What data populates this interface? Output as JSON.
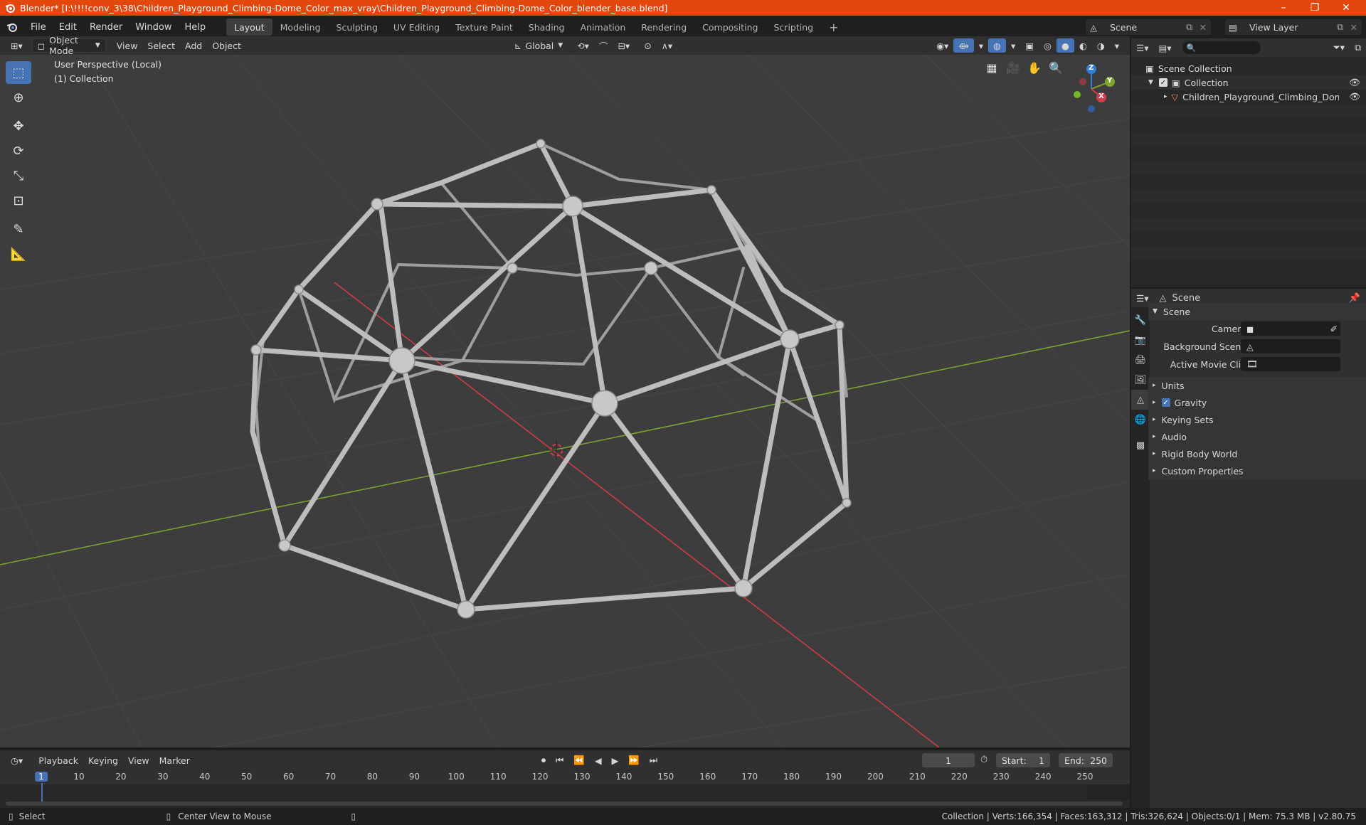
{
  "window": {
    "title": "Blender* [I:\\!!!!conv_3\\38\\Children_Playground_Climbing-Dome_Color_max_vray\\Children_Playground_Climbing-Dome_Color_blender_base.blend]",
    "minimize": "–",
    "maximize": "❐",
    "close": "✕"
  },
  "menu": [
    "File",
    "Edit",
    "Render",
    "Window",
    "Help"
  ],
  "workspaces": [
    "Layout",
    "Modeling",
    "Sculpting",
    "UV Editing",
    "Texture Paint",
    "Shading",
    "Animation",
    "Rendering",
    "Compositing",
    "Scripting"
  ],
  "active_workspace": "Layout",
  "add_workspace": "+",
  "scene_selector": "Scene",
  "view_layer_selector": "View Layer",
  "viewport_header": {
    "mode": "Object Mode",
    "menus": [
      "View",
      "Select",
      "Add",
      "Object"
    ],
    "orientation": "Global"
  },
  "viewport": {
    "perspective_label": "User Perspective (Local)",
    "collection_label": "(1) Collection",
    "axes": {
      "x": "X",
      "y": "Y",
      "z": "Z"
    }
  },
  "outliner": {
    "root": "Scene Collection",
    "collection": "Collection",
    "object": "Children_Playground_Climbing_Dome_Color_"
  },
  "properties": {
    "tab_title": "Scene",
    "panel_title": "Scene",
    "camera_label": "Camera",
    "camera_value": "",
    "background_scene_label": "Background Scene",
    "active_movie_clip_label": "Active Movie Clip",
    "sections": [
      "Units",
      "Gravity",
      "Keying Sets",
      "Audio",
      "Rigid Body World",
      "Custom Properties"
    ],
    "gravity_checked": true
  },
  "timeline": {
    "menus": [
      "Playback",
      "Keying",
      "View",
      "Marker"
    ],
    "current_frame": "1",
    "start_label": "Start:",
    "start_value": "1",
    "end_label": "End:",
    "end_value": "250",
    "ticks": [
      "1",
      "10",
      "20",
      "30",
      "40",
      "50",
      "60",
      "70",
      "80",
      "90",
      "100",
      "110",
      "120",
      "130",
      "140",
      "150",
      "160",
      "170",
      "180",
      "190",
      "200",
      "210",
      "220",
      "230",
      "240",
      "250"
    ]
  },
  "statusbar": {
    "select": "Select",
    "center_view": "Center View to Mouse",
    "stats": "Collection | Verts:166,354 | Faces:163,312 | Tris:326,624 | Objects:0/1 | Mem: 75.3 MB | v2.80.75"
  },
  "colors": {
    "title_bar": "#e2470e",
    "active_tool": "#4772b3",
    "x_axis": "#d33b4a",
    "y_axis": "#7fa533",
    "z_axis": "#2f7fd8",
    "current_frame": "#4772b3"
  }
}
